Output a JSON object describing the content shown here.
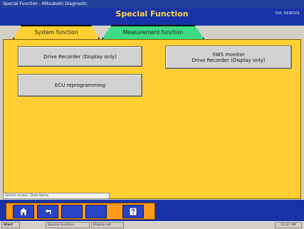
{
  "window": {
    "title": "Special Function - Mitsubishi Diagnostic"
  },
  "header": {
    "title": "Special Function",
    "code": "Ctrl. 0130101"
  },
  "tabs": [
    {
      "label": "System function",
      "active": true
    },
    {
      "label": "Measurement function",
      "active": false
    }
  ],
  "functions": {
    "drive_recorder": "Drive Recorder (Display only)",
    "sws_monitor_line1": "SWS monitor",
    "sws_monitor_line2": "Drive Recorder (Display only)",
    "ecu_reprogramming": "ECU reprogramming"
  },
  "status": {
    "text": "Vehicle model / Data Name"
  },
  "taskbar": {
    "start": "Start",
    "items": [
      "Special Function",
      "Display set"
    ],
    "clock": "12:37 AM"
  },
  "colors": {
    "panel": "#ffcf33",
    "header": "#1733a6",
    "tab_system": "#ffcf33",
    "tab_measurement": "#3fdc85",
    "toolbar": "#ff9a1a"
  },
  "icons": [
    "home-icon",
    "back-icon",
    "help-icon"
  ]
}
